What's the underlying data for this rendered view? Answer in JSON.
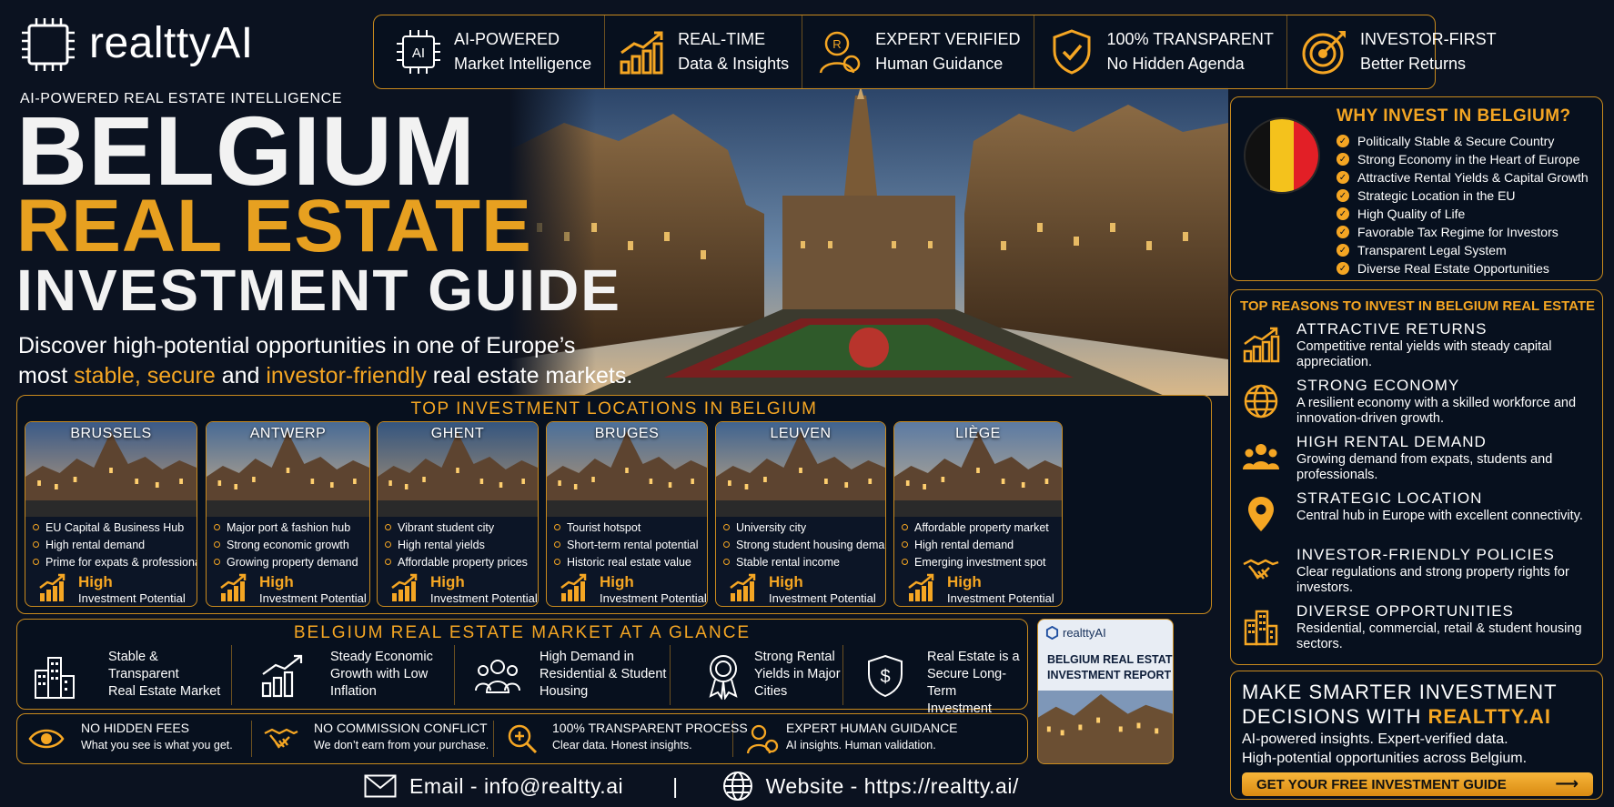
{
  "brand": {
    "name": "realttyAI",
    "tagline": "AI-POWERED REAL ESTATE INTELLIGENCE",
    "chip_label": "AI"
  },
  "features": [
    {
      "icon": "ai-chip-icon",
      "l1": "AI-POWERED",
      "l2": "Market Intelligence"
    },
    {
      "icon": "growth-chart-icon",
      "l1": "REAL-TIME",
      "l2": "Data & Insights"
    },
    {
      "icon": "expert-badge-icon",
      "l1": "EXPERT VERIFIED",
      "l2": "Human Guidance"
    },
    {
      "icon": "shield-check-icon",
      "l1": "100% TRANSPARENT",
      "l2": "No Hidden Agenda"
    },
    {
      "icon": "target-icon",
      "l1": "INVESTOR-FIRST",
      "l2": "Better Returns"
    }
  ],
  "headline": {
    "line1": "BELGIUM",
    "line2": "REAL ESTATE",
    "line3": "INVESTMENT GUIDE",
    "sub_a": "Discover high-potential opportunities in one of Europe’s",
    "sub_b1": "most ",
    "sub_b2": "stable, secure",
    "sub_b3": " and ",
    "sub_b4": "investor-friendly",
    "sub_b5": " real estate markets."
  },
  "why": {
    "title": "WHY INVEST IN BELGIUM?",
    "items": [
      "Politically Stable & Secure Country",
      "Strong Economy in the Heart of Europe",
      "Attractive Rental Yields & Capital Growth",
      "Strategic Location in the EU",
      "High Quality of Life",
      "Favorable Tax Regime for Investors",
      "Transparent Legal System",
      "Diverse Real Estate Opportunities"
    ],
    "flag_colors": [
      "#111111",
      "#f4c21c",
      "#e21f26"
    ]
  },
  "reasons": {
    "title": "TOP REASONS TO INVEST IN BELGIUM REAL ESTATE",
    "items": [
      {
        "icon": "growth-chart-icon",
        "title": "ATTRACTIVE RETURNS",
        "desc": "Competitive rental yields with steady capital appreciation."
      },
      {
        "icon": "globe-icon",
        "title": "STRONG ECONOMY",
        "desc": "A resilient economy with a skilled workforce and innovation-driven growth."
      },
      {
        "icon": "people-icon",
        "title": "HIGH RENTAL DEMAND",
        "desc": "Growing demand from expats, students and professionals."
      },
      {
        "icon": "location-pin-icon",
        "title": "STRATEGIC LOCATION",
        "desc": "Central hub in Europe with excellent connectivity."
      },
      {
        "icon": "handshake-icon",
        "title": "INVESTOR-FRIENDLY POLICIES",
        "desc": "Clear regulations and strong property rights for investors."
      },
      {
        "icon": "buildings-icon",
        "title": "DIVERSE OPPORTUNITIES",
        "desc": "Residential, commercial, retail & student housing sectors."
      }
    ]
  },
  "cta": {
    "l1": "MAKE SMARTER INVESTMENT",
    "l2a": "DECISIONS WITH ",
    "l2b": "REALTTY.AI",
    "d1": "AI-powered insights. Expert-verified data.",
    "d2": "High-potential opportunities across Belgium.",
    "button": "GET YOUR FREE INVESTMENT GUIDE",
    "button_arrow": "⟶"
  },
  "locations": {
    "title": "TOP INVESTMENT LOCATIONS IN BELGIUM",
    "potential_level": "High",
    "potential_label": "Investment Potential",
    "cities": [
      {
        "name": "BRUSSELS",
        "points": [
          "EU Capital & Business Hub",
          "High rental demand",
          "Prime for expats & professionals"
        ]
      },
      {
        "name": "ANTWERP",
        "points": [
          "Major port & fashion hub",
          "Strong economic growth",
          "Growing property demand"
        ]
      },
      {
        "name": "GHENT",
        "points": [
          "Vibrant student city",
          "High rental yields",
          "Affordable property prices"
        ]
      },
      {
        "name": "BRUGES",
        "points": [
          "Tourist hotspot",
          "Short-term rental potential",
          "Historic real estate value"
        ]
      },
      {
        "name": "LEUVEN",
        "points": [
          "University city",
          "Strong student housing demand",
          "Stable rental income"
        ]
      },
      {
        "name": "LIÈGE",
        "points": [
          "Affordable property market",
          "High rental demand",
          "Emerging investment spot"
        ]
      }
    ]
  },
  "glance": {
    "title": "BELGIUM REAL ESTATE MARKET AT A GLANCE",
    "items": [
      {
        "icon": "buildings-icon",
        "lines": [
          "Stable &",
          "Transparent",
          "Real Estate Market"
        ]
      },
      {
        "icon": "growth-chart-icon",
        "lines": [
          "Steady Economic",
          "Growth with Low",
          "Inflation"
        ]
      },
      {
        "icon": "people-icon",
        "lines": [
          "High Demand in",
          "Residential & Student",
          "Housing"
        ]
      },
      {
        "icon": "award-ribbon-icon",
        "lines": [
          "Strong Rental",
          "Yields in Major",
          "Cities"
        ]
      },
      {
        "icon": "shield-dollar-icon",
        "lines": [
          "Real Estate is a",
          "Secure Long-Term",
          "Investment"
        ]
      }
    ]
  },
  "report": {
    "brand": "realttyAI",
    "l1": "BELGIUM REAL ESTATE",
    "l2": "INVESTMENT REPORT"
  },
  "trust": [
    {
      "icon": "eye-icon",
      "a": "NO HIDDEN FEES",
      "b": "What you see is what you get."
    },
    {
      "icon": "handshake-icon",
      "a": "NO COMMISSION CONFLICT",
      "b": "We don’t earn from your purchase."
    },
    {
      "icon": "magnifier-plus-icon",
      "a": "100% TRANSPARENT PROCESS",
      "b": "Clear data. Honest insights."
    },
    {
      "icon": "expert-user-icon",
      "a": "EXPERT HUMAN GUIDANCE",
      "b": "AI insights. Human validation."
    }
  ],
  "footer": {
    "email": "Email - info@realtty.ai",
    "separator": "|",
    "website": "Website - https://realtty.ai/"
  },
  "colors": {
    "accent": "#f5a623",
    "background": "#0b1220",
    "border": "#c98a1d"
  }
}
